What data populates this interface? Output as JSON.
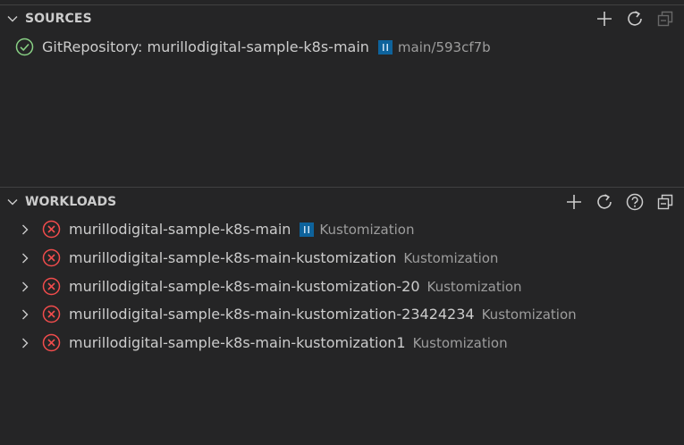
{
  "colors": {
    "background": "#252526",
    "success": "#89d185",
    "error": "#f14c4c",
    "paused": "#0e639c",
    "description": "#9d9d9d"
  },
  "sources": {
    "title": "SOURCES",
    "actions": [
      "add-icon",
      "refresh-icon",
      "collapse-all-icon"
    ],
    "items": [
      {
        "status": "success-check-icon",
        "label": "GitRepository: murillodigital-sample-k8s-main",
        "paused": true,
        "description": "main/593cf7b"
      }
    ]
  },
  "workloads": {
    "title": "WORKLOADS",
    "actions": [
      "add-icon",
      "refresh-icon",
      "help-icon",
      "collapse-all-icon"
    ],
    "items": [
      {
        "status": "error-circle-icon",
        "label": "murillodigital-sample-k8s-main",
        "paused": true,
        "description": "Kustomization"
      },
      {
        "status": "error-circle-icon",
        "label": "murillodigital-sample-k8s-main-kustomization",
        "paused": false,
        "description": "Kustomization"
      },
      {
        "status": "error-circle-icon",
        "label": "murillodigital-sample-k8s-main-kustomization-20",
        "paused": false,
        "description": "Kustomization"
      },
      {
        "status": "error-circle-icon",
        "label": "murillodigital-sample-k8s-main-kustomization-23424234",
        "paused": false,
        "description": "Kustomization"
      },
      {
        "status": "error-circle-icon",
        "label": "murillodigital-sample-k8s-main-kustomization1",
        "paused": false,
        "description": "Kustomization"
      }
    ]
  }
}
